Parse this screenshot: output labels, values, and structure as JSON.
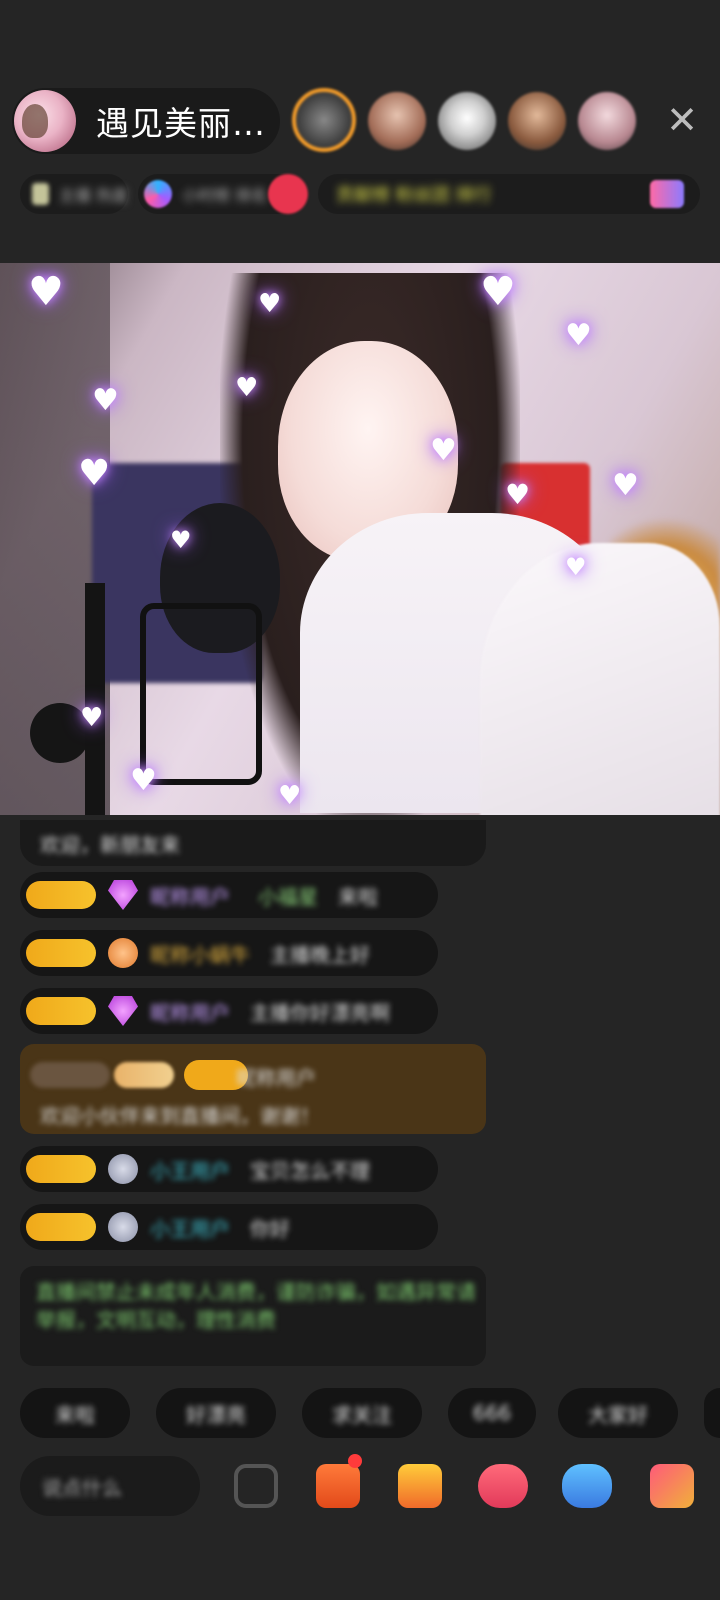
{
  "header": {
    "host_name": "遇见美丽…",
    "close_glyph": "✕",
    "viewer_colors": [
      "#6a6a6a",
      "#b98f7f",
      "#d8d8d8",
      "#9a6b55",
      "#caa2a8"
    ],
    "stat_chips": [
      {
        "text": "主播 热度"
      },
      {
        "text": "小时榜 排名"
      },
      {
        "text": "贡献榜 粉丝团 排行"
      }
    ]
  },
  "chat": {
    "top_line": "欢迎，新朋友来",
    "messages": [
      {
        "name": "昵称用户",
        "level": "小福星",
        "text": "来啦"
      },
      {
        "name": "昵称小蜗牛",
        "level": "",
        "text": "主播晚上好"
      },
      {
        "name": "昵称用户",
        "level": "",
        "text": "主播你好漂亮啊"
      },
      {
        "name": "昵称用户",
        "level": "",
        "text": "欢迎小伙伴来到直播间，谢谢！"
      },
      {
        "name": "小王用户",
        "level": "",
        "text": "宝贝怎么不理"
      },
      {
        "name": "小王用户",
        "level": "",
        "text": "你好"
      }
    ],
    "notice": "直播间禁止未成年人消费，谨防诈骗，如遇异常请举报，文明互动，理性消费"
  },
  "quick_replies": [
    "来啦",
    "好漂亮",
    "求关注",
    "666",
    "大家好"
  ],
  "comment_placeholder": "说点什么",
  "colors": {
    "background": "#252525",
    "badge": "#f0a91a",
    "accent_orange": "#f09a2a",
    "notice_green": "#7ecb6f"
  }
}
